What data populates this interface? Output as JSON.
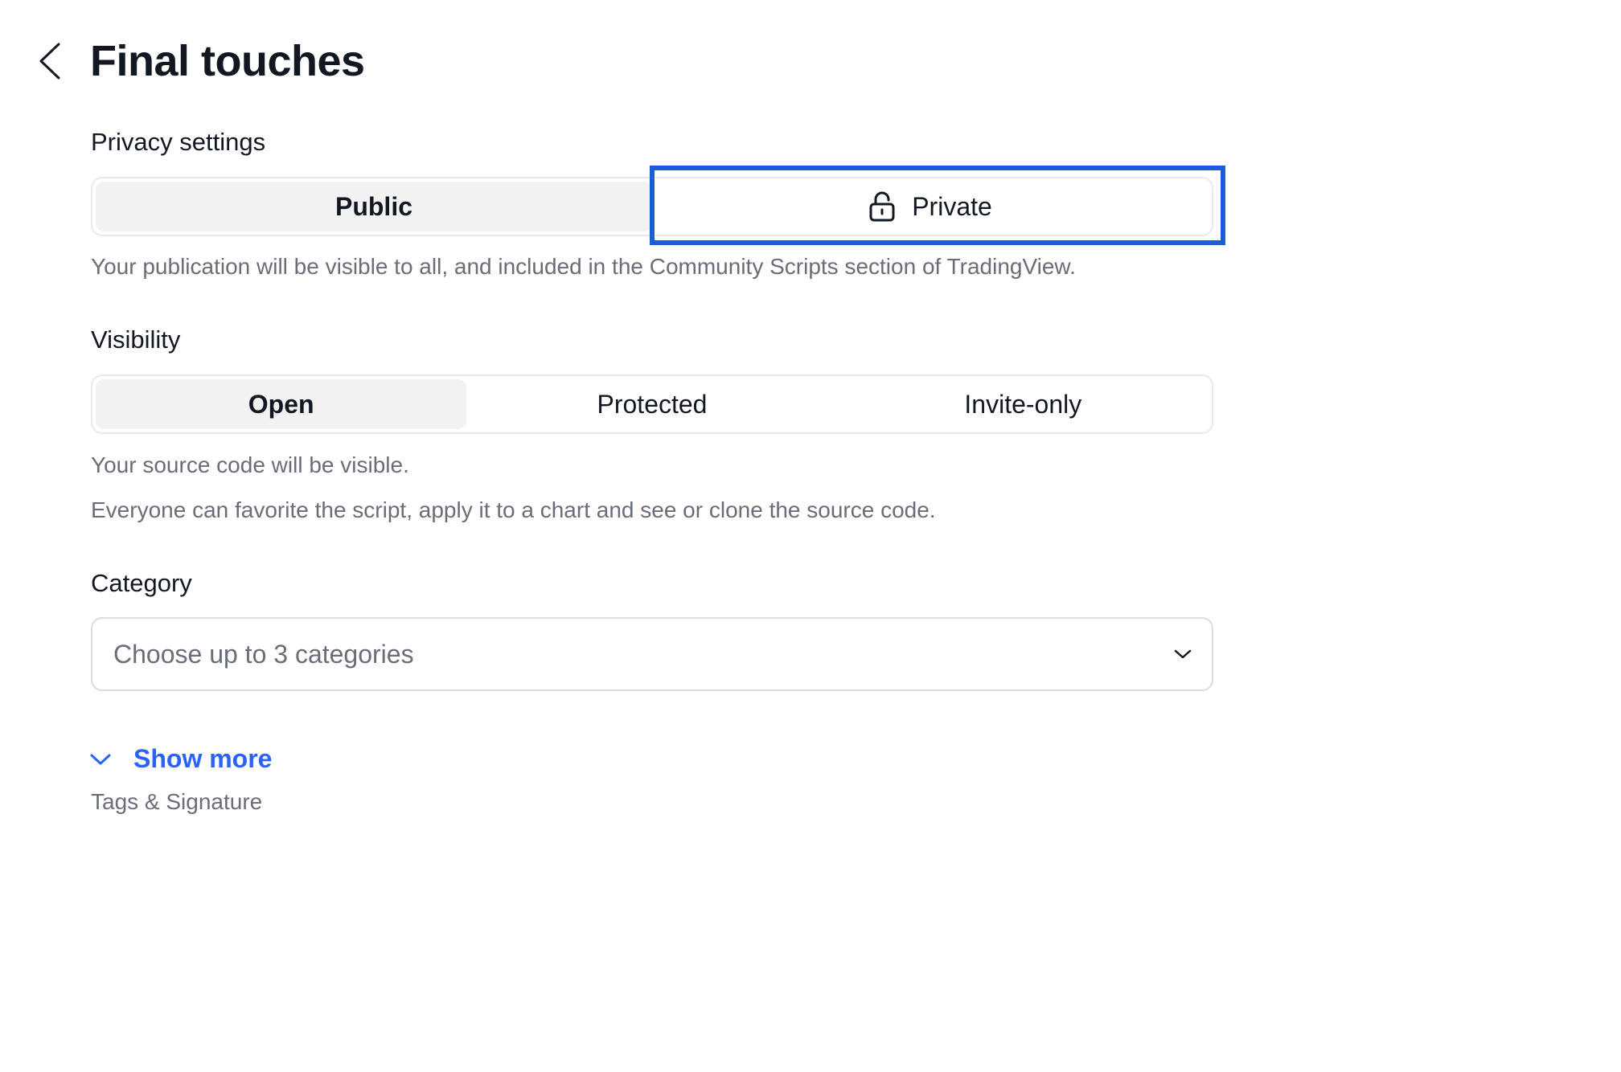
{
  "header": {
    "title": "Final touches",
    "back_icon": "chevron-left-icon"
  },
  "privacy": {
    "label": "Privacy settings",
    "options": [
      {
        "label": "Public",
        "selected": true
      },
      {
        "label": "Private",
        "selected": false,
        "icon": "lock-icon"
      }
    ],
    "description": "Your publication will be visible to all, and included in the Community Scripts section of TradingView."
  },
  "visibility": {
    "label": "Visibility",
    "options": [
      {
        "label": "Open",
        "selected": true
      },
      {
        "label": "Protected",
        "selected": false
      },
      {
        "label": "Invite-only",
        "selected": false
      }
    ],
    "description_1": "Your source code will be visible.",
    "description_2": "Everyone can favorite the script, apply it to a chart and see or clone the source code."
  },
  "category": {
    "label": "Category",
    "placeholder": "Choose up to 3 categories",
    "icon": "chevron-down-icon"
  },
  "show_more": {
    "label": "Show more",
    "caption": "Tags & Signature",
    "icon": "chevron-down-icon"
  },
  "colors": {
    "highlight": "#1e5bd6",
    "link": "#2962ff",
    "muted_text": "#6a6d78",
    "active_segment": "#f2f2f2"
  }
}
